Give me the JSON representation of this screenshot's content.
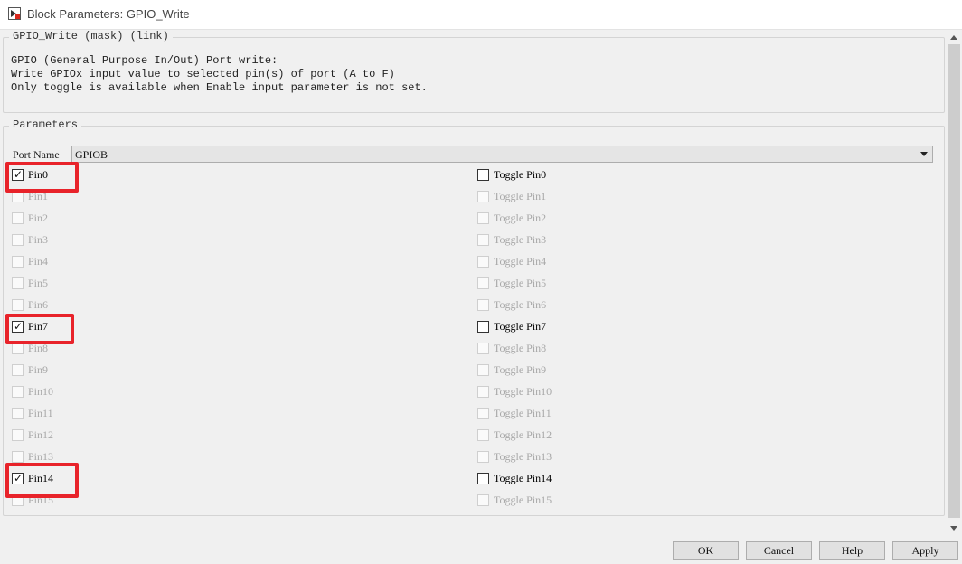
{
  "window": {
    "title": "Block Parameters: GPIO_Write"
  },
  "description_group": {
    "legend": "GPIO_Write (mask) (link)",
    "lines": [
      "GPIO (General Purpose In/Out) Port write:",
      "Write GPIOx input value to selected pin(s) of port (A to F)",
      "Only toggle is available when Enable input parameter is not set."
    ]
  },
  "parameters_group": {
    "legend": "Parameters",
    "port_name_label": "Port Name",
    "port_name_value": "GPIOB"
  },
  "pins": [
    {
      "label": "Pin0",
      "checked": true,
      "enabled": true
    },
    {
      "label": "Pin1",
      "checked": false,
      "enabled": false
    },
    {
      "label": "Pin2",
      "checked": false,
      "enabled": false
    },
    {
      "label": "Pin3",
      "checked": false,
      "enabled": false
    },
    {
      "label": "Pin4",
      "checked": false,
      "enabled": false
    },
    {
      "label": "Pin5",
      "checked": false,
      "enabled": false
    },
    {
      "label": "Pin6",
      "checked": false,
      "enabled": false
    },
    {
      "label": "Pin7",
      "checked": true,
      "enabled": true
    },
    {
      "label": "Pin8",
      "checked": false,
      "enabled": false
    },
    {
      "label": "Pin9",
      "checked": false,
      "enabled": false
    },
    {
      "label": "Pin10",
      "checked": false,
      "enabled": false
    },
    {
      "label": "Pin11",
      "checked": false,
      "enabled": false
    },
    {
      "label": "Pin12",
      "checked": false,
      "enabled": false
    },
    {
      "label": "Pin13",
      "checked": false,
      "enabled": false
    },
    {
      "label": "Pin14",
      "checked": true,
      "enabled": true
    },
    {
      "label": "Pin15",
      "checked": false,
      "enabled": false
    }
  ],
  "toggles": [
    {
      "label": "Toggle Pin0",
      "checked": false,
      "enabled": true
    },
    {
      "label": "Toggle Pin1",
      "checked": false,
      "enabled": false
    },
    {
      "label": "Toggle Pin2",
      "checked": false,
      "enabled": false
    },
    {
      "label": "Toggle Pin3",
      "checked": false,
      "enabled": false
    },
    {
      "label": "Toggle Pin4",
      "checked": false,
      "enabled": false
    },
    {
      "label": "Toggle Pin5",
      "checked": false,
      "enabled": false
    },
    {
      "label": "Toggle Pin6",
      "checked": false,
      "enabled": false
    },
    {
      "label": "Toggle Pin7",
      "checked": false,
      "enabled": true
    },
    {
      "label": "Toggle Pin8",
      "checked": false,
      "enabled": false
    },
    {
      "label": "Toggle Pin9",
      "checked": false,
      "enabled": false
    },
    {
      "label": "Toggle Pin10",
      "checked": false,
      "enabled": false
    },
    {
      "label": "Toggle Pin11",
      "checked": false,
      "enabled": false
    },
    {
      "label": "Toggle Pin12",
      "checked": false,
      "enabled": false
    },
    {
      "label": "Toggle Pin13",
      "checked": false,
      "enabled": false
    },
    {
      "label": "Toggle Pin14",
      "checked": false,
      "enabled": true
    },
    {
      "label": "Toggle Pin15",
      "checked": false,
      "enabled": false
    }
  ],
  "highlighted_pins": [
    "Pin0",
    "Pin7",
    "Pin14"
  ],
  "highlight_color": "#e8232a",
  "buttons": {
    "ok": "OK",
    "cancel": "Cancel",
    "help": "Help",
    "apply": "Apply"
  }
}
